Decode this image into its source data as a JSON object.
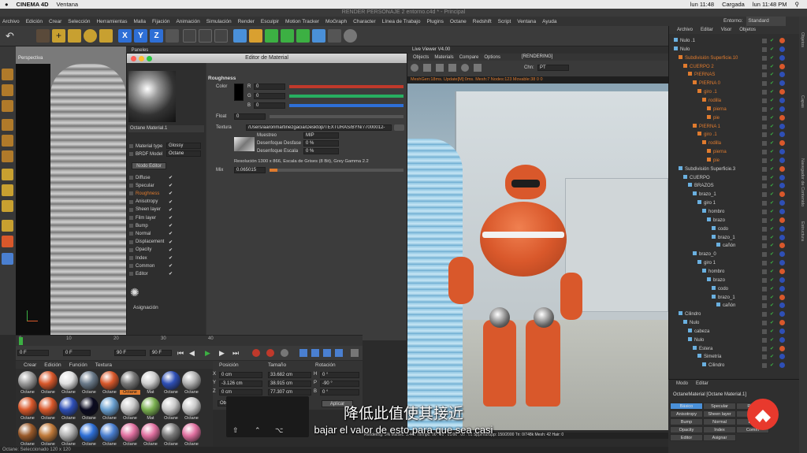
{
  "macbar": {
    "app": "CINEMA 4D",
    "menu": "Ventana",
    "clock_left": "lun 11:48",
    "battery": "Cargada",
    "clock_right": "lun 11:48 PM"
  },
  "c4d": {
    "window_title": "RENDER PERSONAJE 2 entorno.c4d * - Principal",
    "menu": [
      "Archivo",
      "Edición",
      "Crear",
      "Selección",
      "Herramientas",
      "Malla",
      "Fijación",
      "Animación",
      "Simulación",
      "Render",
      "Esculpir",
      "Motion Tracker",
      "MoGraph",
      "Character",
      "Línea de Trabajo",
      "Plugins",
      "Octane",
      "Redshift",
      "Script",
      "Ventana",
      "Ayuda"
    ],
    "entorno_label": "Entorno:",
    "entorno_value": "Standard",
    "toolbar_axes": [
      "X",
      "Y",
      "Z"
    ]
  },
  "viewport": {
    "menu": [
      "Vista",
      "Cámaras",
      "Mostrar",
      "Opciones",
      "Filtrar",
      "Paneles"
    ],
    "label": "Perspectiva"
  },
  "material_editor": {
    "title": "Editor de Material",
    "material_name": "Octane Material.1",
    "material_type_label": "Material type",
    "material_type_value": "Glossy",
    "brdf_label": "BRDF Model",
    "brdf_value": "Octane",
    "node_editor": "Nodo Editor",
    "channels": [
      "Diffuse",
      "Specular",
      "Roughness",
      "Anisotropy",
      "Sheen layer",
      "Film layer",
      "Bump",
      "Normal",
      "Displacement",
      "Opacity",
      "Index",
      "Common",
      "Editor"
    ],
    "active_channel": "Roughness",
    "assign_label": "Asignación",
    "section": "Roughness",
    "color_label": "Color",
    "rgb": [
      {
        "k": "R",
        "v": "0"
      },
      {
        "k": "G",
        "v": "0"
      },
      {
        "k": "B",
        "v": "0"
      }
    ],
    "float_label": "Float",
    "float_value": "0",
    "texture_label": "Textura",
    "texture_path": "/Users/aaronmartinezgacia/Desktop/TEXTURAS/BYN/77000012-",
    "muestreo_label": "Muestreo",
    "muestreo_value": "MIP",
    "desenfoque_desfase_label": "Desenfoque Desfase",
    "desenfoque_desfase_value": "0 %",
    "desenfoque_escala_label": "Desenfoque Escala",
    "desenfoque_escala_value": "0 %",
    "resolution": "Resolución 1300 x 866, Escala de Grises (8 Bit), Grey Gamma 2.2",
    "mix_label": "Mix",
    "mix_value": "0.065015"
  },
  "live_viewer": {
    "title": "Live Viewer V4.00",
    "menu": [
      "Objects",
      "Materials",
      "Compare",
      "Options"
    ],
    "state": "[RENDERING]",
    "channel_label": "Chn:",
    "channel_value": "PT",
    "status": "MeshGen:18ms. Update[M]:0ms. Mesh:7 Nodes:123 Movable:38  0  0",
    "bottom_status": "Rendering: 5%    Ms/sec: 3.442    Tiempo: 00 : 00 : 01/00 : 00 : 01    Spp/maxspp: 150/2000    Tri: 0/748k    Mesh: 42    Hair: 0"
  },
  "timeline": {
    "ticks": [
      "0",
      "10",
      "20",
      "30",
      "40"
    ],
    "current_frame": "0 F",
    "start_frame": "0 F",
    "end_frame": "90 F",
    "end_frame_2": "90 F"
  },
  "material_manager": {
    "menu": [
      "Crear",
      "Edición",
      "Función",
      "Textura"
    ],
    "row1": [
      "Octane",
      "Octane",
      "Octane",
      "Octane",
      "Octane",
      "Octane",
      "Mat",
      "Octane",
      "Octane"
    ],
    "row2": [
      "Octane",
      "Octane",
      "Octane",
      "Octane",
      "Octane",
      "Octane",
      "Mat",
      "Octane",
      "Octane"
    ],
    "row3": [
      "Octane",
      "Octane",
      "Octane",
      "Octane",
      "Octane",
      "Octane",
      "Octane",
      "Octane",
      "Octane"
    ],
    "selected": "Octane"
  },
  "coordinates": {
    "headers": [
      "Posición",
      "Tamaño",
      "Rotación"
    ],
    "rows": [
      {
        "axis": "X",
        "pos": "0 cm",
        "size": "33.682 cm",
        "rot_axis": "H",
        "rot": "0 °"
      },
      {
        "axis": "Y",
        "pos": "-3.126 cm",
        "size": "38.915 cm",
        "rot_axis": "P",
        "rot": "-90 °"
      },
      {
        "axis": "Z",
        "pos": "0 cm",
        "size": "77.307 cm",
        "rot_axis": "B",
        "rot": "0 °"
      }
    ],
    "mode": "Objeto (Rel)",
    "apply": "Aplicar"
  },
  "bottom_status": "Octane: Seleccionado 120 x 120",
  "object_manager": {
    "menu": [
      "Archivo",
      "Editar",
      "Visor",
      "Objetos"
    ],
    "items": [
      {
        "name": "Nulo .1",
        "indent": 0
      },
      {
        "name": "Nulo",
        "indent": 0
      },
      {
        "name": "Subdivisión Superficie.10",
        "indent": 1
      },
      {
        "name": "CUERPO 2",
        "indent": 2
      },
      {
        "name": "PIERNAS",
        "indent": 3
      },
      {
        "name": "PIERNA 0",
        "indent": 4
      },
      {
        "name": "giro .1",
        "indent": 5
      },
      {
        "name": "rodilla",
        "indent": 6
      },
      {
        "name": "pierna",
        "indent": 7
      },
      {
        "name": "pie",
        "indent": 7
      },
      {
        "name": "PIERNA 1",
        "indent": 4
      },
      {
        "name": "giro .1",
        "indent": 5
      },
      {
        "name": "rodilla",
        "indent": 6
      },
      {
        "name": "pierna",
        "indent": 7
      },
      {
        "name": "pie",
        "indent": 7
      },
      {
        "name": "Subdivisión Superficie.3",
        "indent": 1
      },
      {
        "name": "CUERPO",
        "indent": 2
      },
      {
        "name": "BRAZOS",
        "indent": 3
      },
      {
        "name": "brazo_1",
        "indent": 4
      },
      {
        "name": "giro 1",
        "indent": 5
      },
      {
        "name": "hombro",
        "indent": 6
      },
      {
        "name": "brazo",
        "indent": 7
      },
      {
        "name": "codo",
        "indent": 8
      },
      {
        "name": "brazo_1",
        "indent": 8
      },
      {
        "name": "cañón",
        "indent": 9
      },
      {
        "name": "brazo_0",
        "indent": 4
      },
      {
        "name": "giro 1",
        "indent": 5
      },
      {
        "name": "hombro",
        "indent": 6
      },
      {
        "name": "brazo",
        "indent": 7
      },
      {
        "name": "codo",
        "indent": 8
      },
      {
        "name": "brazo_1",
        "indent": 8
      },
      {
        "name": "cañón",
        "indent": 9
      },
      {
        "name": "Cilindro",
        "indent": 1
      },
      {
        "name": "Nulo",
        "indent": 2
      },
      {
        "name": "cabeza",
        "indent": 3
      },
      {
        "name": "Nulo",
        "indent": 3
      },
      {
        "name": "Estera",
        "indent": 4
      },
      {
        "name": "Simetría",
        "indent": 5
      },
      {
        "name": "Cilindro",
        "indent": 6
      }
    ]
  },
  "attributes": {
    "menu": [
      "Modo",
      "Editar"
    ],
    "title": "OctaneMaterial [Octane Material.1]",
    "tabs": [
      "Básico",
      "Specular",
      "Roug",
      "Anisotropy",
      "Sheen layer",
      "Film",
      "Bump",
      "Normal",
      "Disp",
      "Opacity",
      "Index",
      "Comm",
      "Editor",
      "Asignar"
    ]
  },
  "right_strip_labels": [
    "Objetos",
    "Capas",
    "Navegador de Contenido",
    "Estructura"
  ],
  "subtitles": {
    "zh": "降低此值使其接近",
    "es": "bajar el valor de esto para que sea casi"
  },
  "colors": {
    "accent": "#e07b2e",
    "brand": "#e8392d",
    "robot": "#d9582b"
  }
}
